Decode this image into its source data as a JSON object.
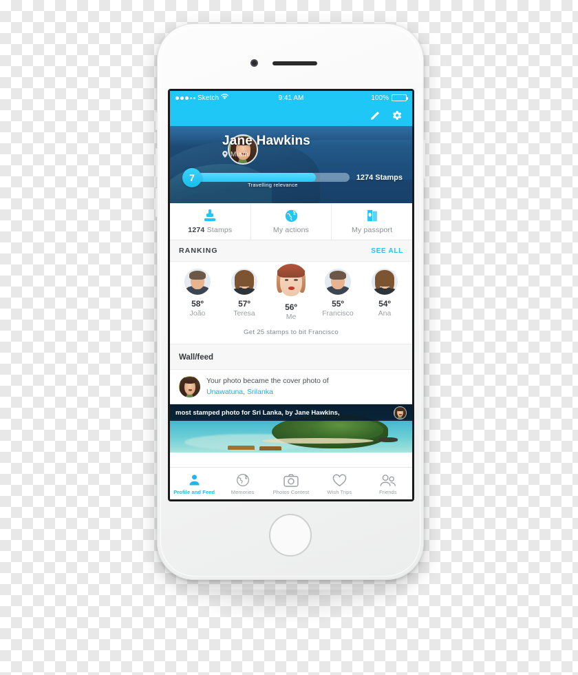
{
  "statusbar": {
    "carrier": "Sketch",
    "time": "9:41 AM",
    "battery_label": "100%",
    "wifi_icon": "wifi-icon",
    "signal_icon": "signal-dots-icon"
  },
  "actionbar": {
    "edit_icon": "pencil-icon",
    "settings_icon": "gear-icon"
  },
  "profile": {
    "name": "Jane Hawkins",
    "location": "Miami",
    "location_icon": "map-pin-icon",
    "level": "7",
    "progress_label": "Travelling relevance",
    "progress_percent": 78,
    "stamps_total": "1274 Stamps",
    "avatar": "user-avatar"
  },
  "stat_tabs": [
    {
      "id": "stamps",
      "value": "1274",
      "label": "Stamps",
      "icon": "stamp-icon"
    },
    {
      "id": "actions",
      "value": "",
      "label": "My actions",
      "icon": "globe-icon"
    },
    {
      "id": "passport",
      "value": "",
      "label": "My passport",
      "icon": "passport-icon"
    }
  ],
  "ranking": {
    "title": "RANKING",
    "see_all": "SEE ALL",
    "items": [
      {
        "position": "58º",
        "name": "João",
        "avatar": "male-avatar",
        "is_me": false
      },
      {
        "position": "57º",
        "name": "Teresa",
        "avatar": "female-avatar",
        "is_me": false
      },
      {
        "position": "56º",
        "name": "Me",
        "avatar": "me-avatar",
        "is_me": true
      },
      {
        "position": "55º",
        "name": "Francisco",
        "avatar": "male-avatar",
        "is_me": false
      },
      {
        "position": "54º",
        "name": "Ana",
        "avatar": "female-avatar",
        "is_me": false
      }
    ],
    "hint": "Get 25 stamps to bit Francisco"
  },
  "wall": {
    "title": "Wall/feed",
    "feed": [
      {
        "text": "Your photo became the cover photo of",
        "link": "Unawatuna, Srilanka",
        "avatar": "user-avatar"
      }
    ]
  },
  "photo_card": {
    "caption": "most stamped photo for Sri Lanka, by Jane Hawkins,",
    "avatar": "user-avatar",
    "image": "tropical-island-photo"
  },
  "tabbar": [
    {
      "id": "profile-and-feed",
      "label": "Profile and Feed",
      "icon": "person-icon",
      "active": true
    },
    {
      "id": "memories",
      "label": "Memories",
      "icon": "globe-icon",
      "active": false
    },
    {
      "id": "photos-contest",
      "label": "Photos Contest",
      "icon": "camera-icon",
      "active": false
    },
    {
      "id": "wish-trips",
      "label": "Wish Trips",
      "icon": "heart-icon",
      "active": false
    },
    {
      "id": "friends",
      "label": "Friends",
      "icon": "people-icon",
      "active": false
    }
  ],
  "colors": {
    "accent": "#1ec7f5",
    "accent_dark": "#21b6ea",
    "link": "#2aa9e0",
    "text_dark": "#33363a",
    "text_muted": "#9a9ea1"
  }
}
